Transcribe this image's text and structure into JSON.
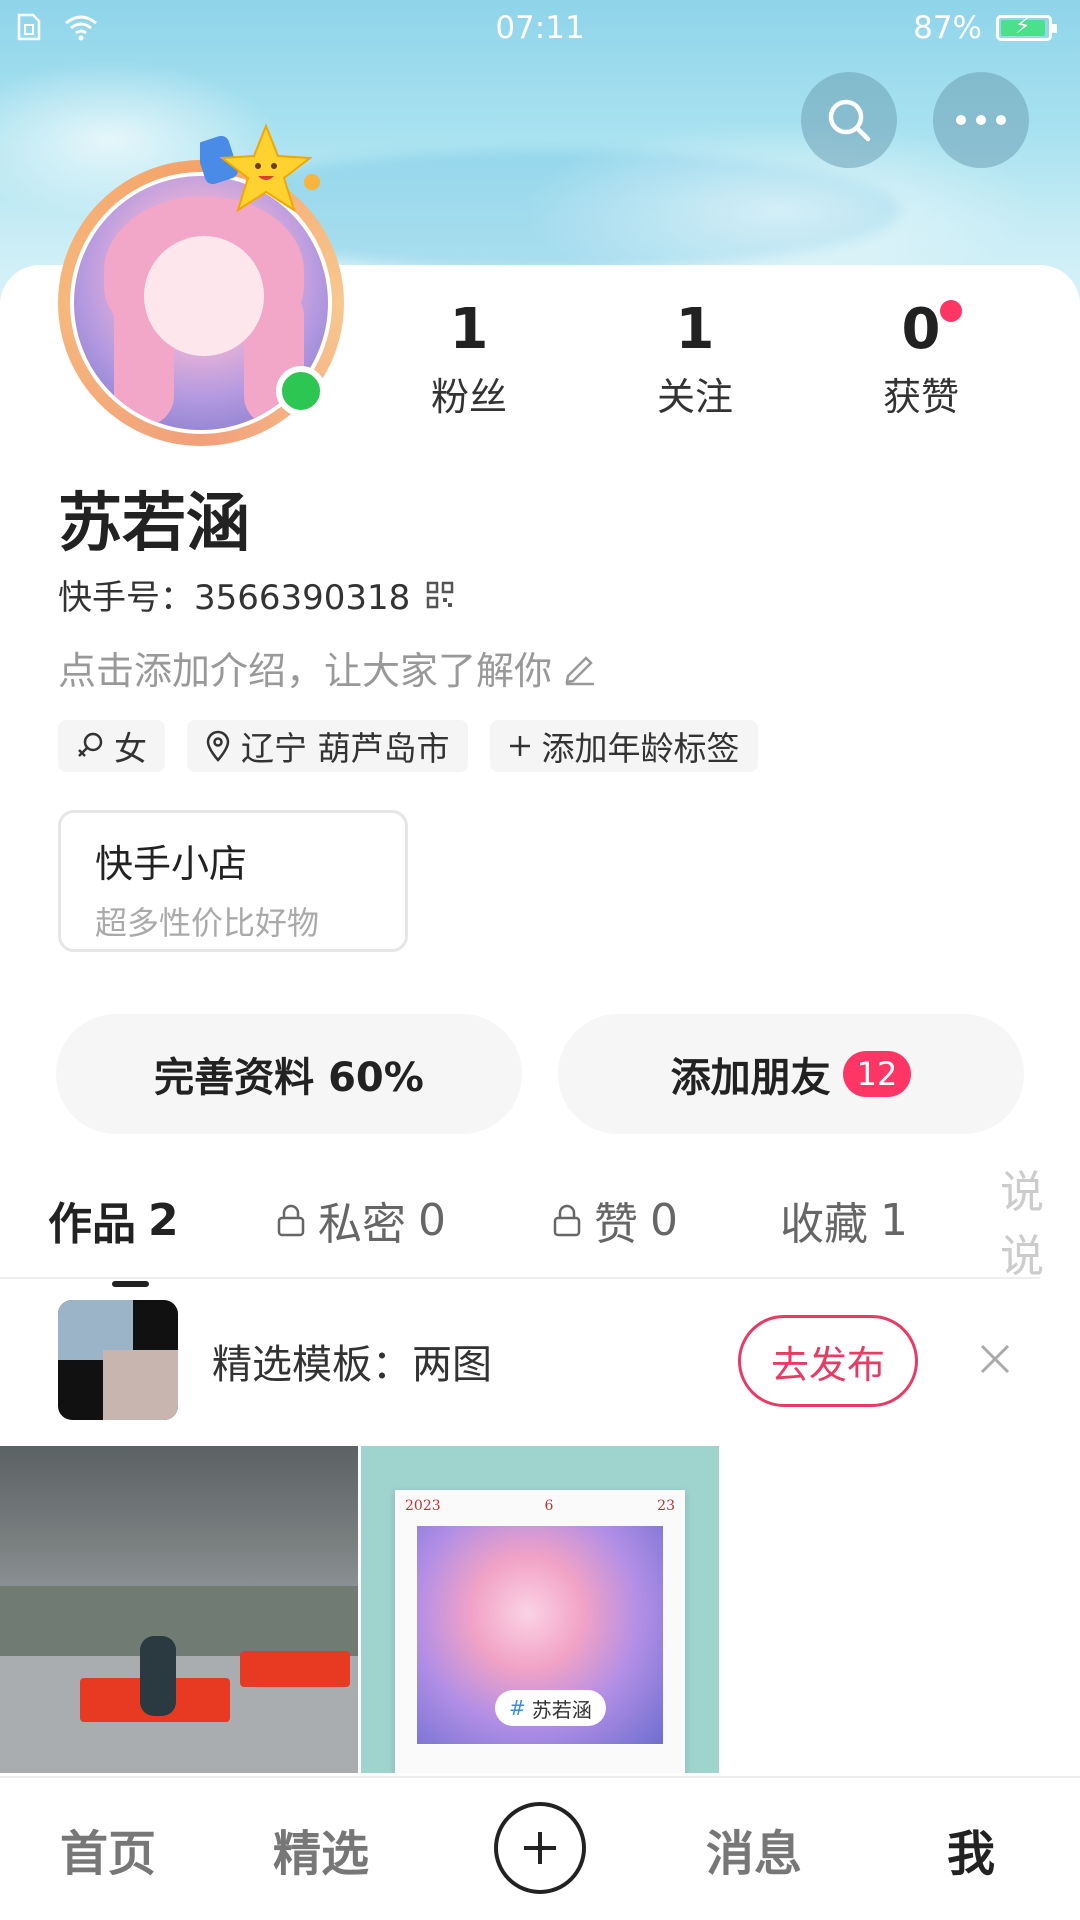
{
  "status_bar": {
    "time": "07:11",
    "battery": "87%"
  },
  "profile": {
    "name": "苏若涵",
    "kuaishou_id_label": "快手号：",
    "kuaishou_id": "3566390318",
    "intro_placeholder": "点击添加介绍，让大家了解你",
    "stats": [
      {
        "value": "1",
        "label": "粉丝"
      },
      {
        "value": "1",
        "label": "关注"
      },
      {
        "value": "0",
        "label": "获赞"
      }
    ],
    "tags": {
      "gender": "女",
      "location": "辽宁 葫芦岛市",
      "age_add": "添加年龄标签"
    }
  },
  "shop": {
    "title": "快手小店",
    "subtitle": "超多性价比好物"
  },
  "actions": {
    "complete_profile": "完善资料 60%",
    "add_friends": "添加朋友",
    "add_friends_badge": "12"
  },
  "tabs": [
    {
      "label": "作品",
      "count": "2"
    },
    {
      "label": "私密",
      "count": "0"
    },
    {
      "label": "赞",
      "count": "0"
    },
    {
      "label": "收藏",
      "count": "1"
    },
    {
      "label": "说说",
      "count": ""
    }
  ],
  "template_banner": {
    "text": "精选模板：两图",
    "button": "去发布"
  },
  "works": {
    "work2_date": [
      "2023",
      "6",
      "23"
    ],
    "work2_tag": "苏若涵"
  },
  "nav": {
    "home": "首页",
    "featured": "精选",
    "messages": "消息",
    "me": "我"
  },
  "colors": {
    "accent": "#fe3666",
    "online": "#2ec653",
    "sky": "#8fd4ea"
  }
}
